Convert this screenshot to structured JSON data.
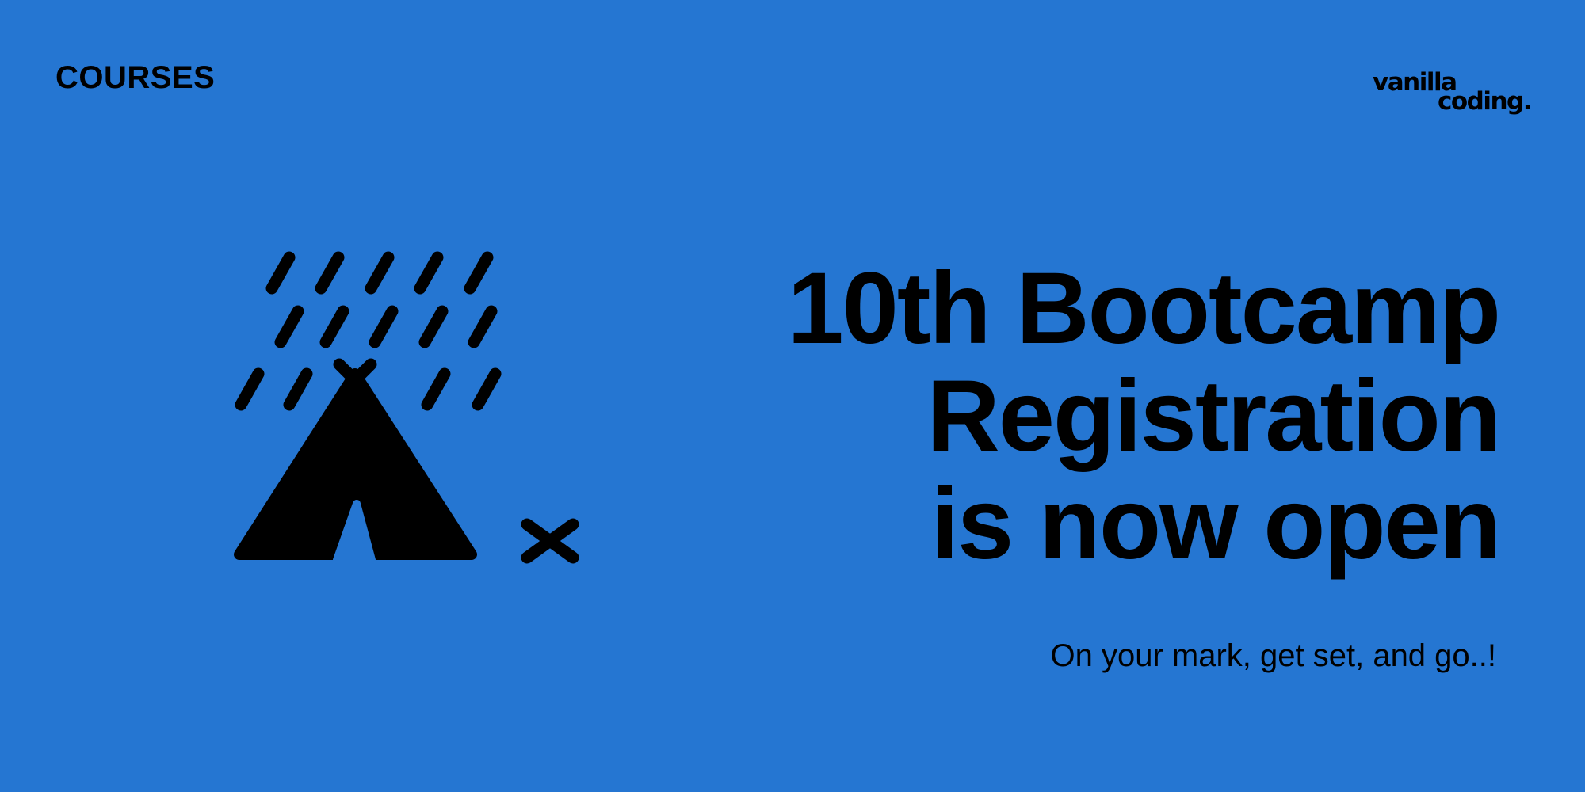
{
  "header": {
    "category": "COURSES",
    "brand": {
      "line1": "vanilla",
      "line2": "coding."
    }
  },
  "main": {
    "headline": {
      "line1": "10th Bootcamp",
      "line2": "Registration",
      "line3": "is now open"
    },
    "tagline": "On your mark, get set, and go..!"
  },
  "illustration": {
    "icons": [
      "rain-icon",
      "tent-icon",
      "cross-mark-icon"
    ]
  },
  "colors": {
    "background": "#2576d2",
    "foreground": "#000000"
  }
}
